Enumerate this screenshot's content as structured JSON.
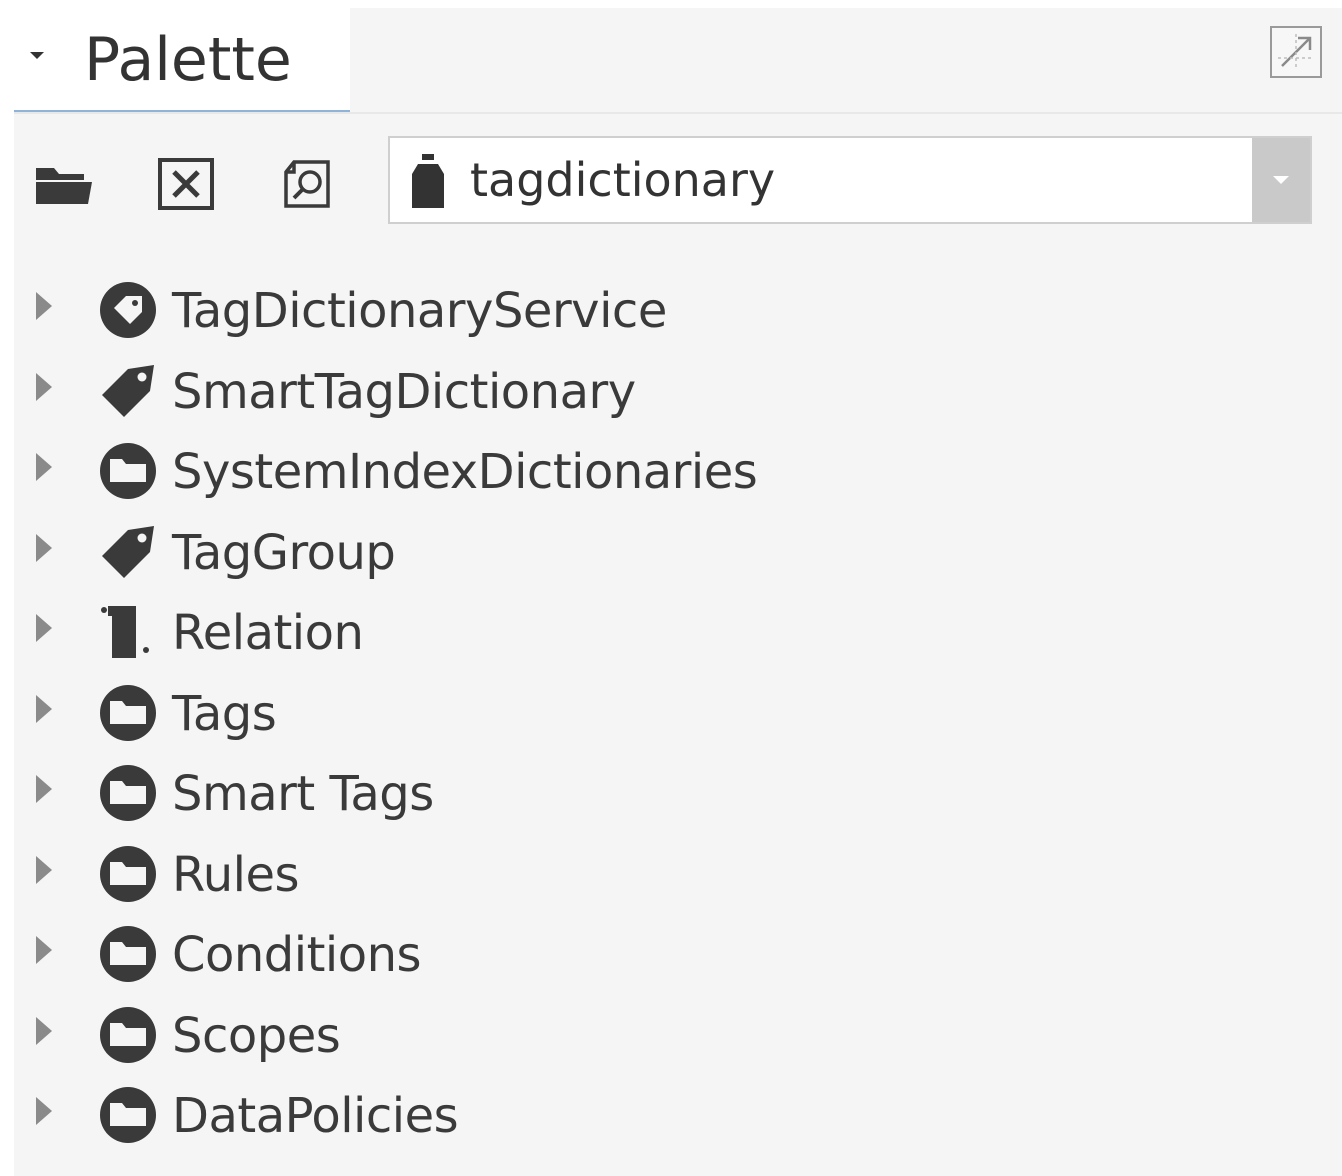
{
  "palette": {
    "title": "Palette",
    "collapse_icon": "caret-down-icon",
    "maximize_icon": "maximize-icon"
  },
  "toolbar": {
    "open_icon": "folder-open-icon",
    "close_icon": "close-box-icon",
    "find_icon": "find-icon",
    "module_select": {
      "value": "tagdictionary",
      "icon": "module-jar-icon"
    }
  },
  "tree": {
    "items": [
      {
        "label": "TagDictionaryService",
        "icon": "tag-service-icon"
      },
      {
        "label": "SmartTagDictionary",
        "icon": "tag-icon"
      },
      {
        "label": "SystemIndexDictionaries",
        "icon": "folder-icon"
      },
      {
        "label": "TagGroup",
        "icon": "tag-icon"
      },
      {
        "label": "Relation",
        "icon": "relation-icon"
      },
      {
        "label": "Tags",
        "icon": "folder-icon"
      },
      {
        "label": "Smart Tags",
        "icon": "folder-icon"
      },
      {
        "label": "Rules",
        "icon": "folder-icon"
      },
      {
        "label": "Conditions",
        "icon": "folder-icon"
      },
      {
        "label": "Scopes",
        "icon": "folder-icon"
      },
      {
        "label": "DataPolicies",
        "icon": "folder-icon"
      }
    ]
  },
  "colors": {
    "panel_bg": "#f5f5f5",
    "icon_dark": "#3a3a3a",
    "tab_underline": "#8fb4d8"
  }
}
